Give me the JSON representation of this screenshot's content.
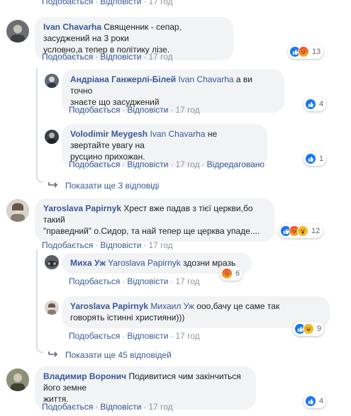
{
  "labels": {
    "like": "Подобається",
    "reply": "Відповісти",
    "edited": "Відредаговано",
    "dot": "·"
  },
  "top_actions": {
    "like": "Подобається",
    "reply": "Відповісти",
    "time": "17 год"
  },
  "comments": [
    {
      "author": "Ivan Chavarha",
      "text": "Священник - сепар, засуджений на 3 роки",
      "text2": "условно,а тепер в політику лізе.",
      "time": "17 год",
      "reactions": [
        "like-icon",
        "angry-icon"
      ],
      "reaction_count": "13"
    },
    {
      "author": "Андріана Ганжерлі-Білей",
      "mention": "Ivan Chavarha",
      "text": "а ви точно",
      "text2": "знаєте що засуджений",
      "time": "17 год",
      "reactions": [
        "like-icon"
      ],
      "reaction_count": "4"
    },
    {
      "author": "Volodimir Meygesh",
      "mention": "Ivan Chavarha",
      "text": "не звертайте увагу на",
      "text2": "русцино прихожан.",
      "time": "17 год",
      "edited": "Відредаговано",
      "reactions": [
        "like-icon"
      ],
      "reaction_count": "1"
    },
    {
      "author": "Yaroslava Papirnyk",
      "text": "Хрест вже падав з тієї церкви,бо такий",
      "text2": "\"праведний\" о.Сидор, та най тепер ще церква упаде....",
      "time": "17 год",
      "reactions": [
        "like-icon",
        "angry-icon",
        "wow-icon"
      ],
      "reaction_count": "12"
    },
    {
      "author": "Миха Уж",
      "mention": "Yaroslava Papirnyk",
      "text": "здозни мразь",
      "time": "17 год",
      "reactions": [
        "angry-icon"
      ],
      "reaction_count": "6"
    },
    {
      "author": "Yaroslava Papirnyk",
      "mention": "Михаил Уж",
      "text": "ооо,бачу це саме так",
      "text2": "говорять істинні християни)))",
      "time": "17 год",
      "reactions": [
        "like-icon",
        "haha-icon"
      ],
      "reaction_count": "9"
    },
    {
      "author": "Владимир Воронич",
      "text": "Подивитися чим закінчиться його земне",
      "text2": "життя.",
      "time": "17 год",
      "reactions": [
        "like-icon"
      ],
      "reaction_count": "4"
    }
  ],
  "more_replies_1": "Показати ще 3 відповіді",
  "more_replies_2": "Показати ще 45 відповідей",
  "colors": {
    "link": "#385898",
    "bubble": "#f2f3f5",
    "meta": "#90949c",
    "like": "#1877f2"
  }
}
